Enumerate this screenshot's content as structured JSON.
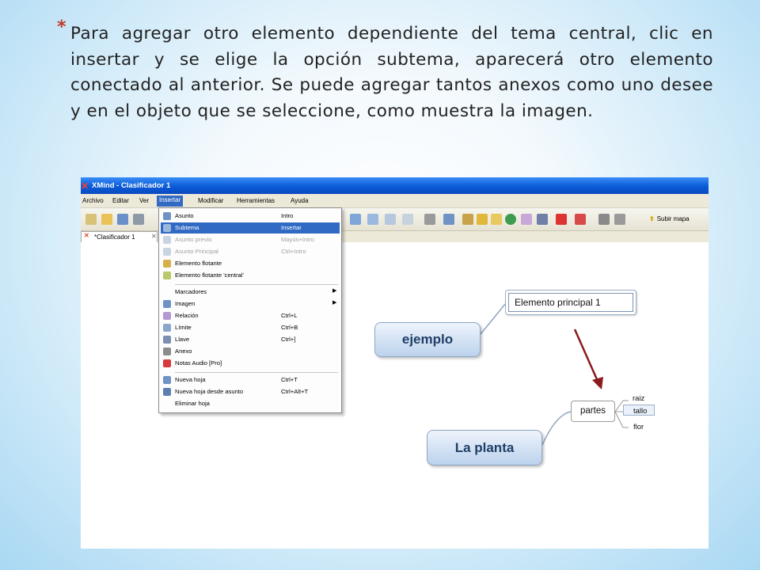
{
  "slide": {
    "bullet": "*",
    "text": "Para agregar otro elemento dependiente del tema central, clic en  insertar y se elige la opción subtema, aparecerá otro elemento conectado al anterior. Se puede agregar tantos anexos como uno desee y en el objeto que se seleccione, como muestra la imagen."
  },
  "app": {
    "window_title": "XMind - Clasificador 1",
    "menus": [
      "Archivo",
      "Editar",
      "Ver",
      "Insertar",
      "Modificar",
      "Herramientas",
      "Ayuda"
    ],
    "active_menu": "Insertar",
    "toolbar_button": "Subir mapa",
    "tab_label": "*Clasificador 1"
  },
  "dropdown": {
    "items": [
      {
        "label": "Asunto",
        "shortcut": "Intro",
        "icon": "topic-icon"
      },
      {
        "label": "Subtema",
        "shortcut": "Insertar",
        "icon": "subtopic-icon"
      },
      {
        "label": "Asunto previo",
        "shortcut": "Mayús+Intro",
        "icon": "prev-topic-icon"
      },
      {
        "label": "Asunto Principal",
        "shortcut": "Ctrl+Intro",
        "icon": "main-topic-icon"
      },
      {
        "label": "Elemento flotante",
        "shortcut": "",
        "icon": "floating-topic-icon"
      },
      {
        "label": "Elemento flotante 'central'",
        "shortcut": "",
        "icon": "floating-central-icon"
      },
      {
        "label": "Marcadores",
        "shortcut": "",
        "icon": ""
      },
      {
        "label": "Imagen",
        "shortcut": "",
        "icon": "image-icon"
      },
      {
        "label": "Relación",
        "shortcut": "Ctrl+L",
        "icon": "relation-icon"
      },
      {
        "label": "Límite",
        "shortcut": "Ctrl+B",
        "icon": "boundary-icon"
      },
      {
        "label": "Llave",
        "shortcut": "Ctrl+]",
        "icon": "summary-icon"
      },
      {
        "label": "Anexo",
        "shortcut": "",
        "icon": "attachment-icon"
      },
      {
        "label": "Notas Audio [Pro]",
        "shortcut": "",
        "icon": "audio-notes-icon"
      },
      {
        "label": "Nueva hoja",
        "shortcut": "Ctrl+T",
        "icon": "new-sheet-icon"
      },
      {
        "label": "Nueva hoja desde asunto",
        "shortcut": "Ctrl+Alt+T",
        "icon": "new-sheet-from-topic-icon"
      },
      {
        "label": "Eliminar hoja",
        "shortcut": "",
        "icon": ""
      }
    ],
    "highlighted": "Subtema"
  },
  "mindmap": {
    "central_1": "ejemplo",
    "main_topic": "Elemento principal  1",
    "central_2": "La planta",
    "subtopic": "partes",
    "leaves": [
      "raiz",
      "tallo",
      "flor"
    ]
  },
  "colors": {
    "highlight": "#316ac5",
    "arrow": "#8b1a1a",
    "node_text": "#1e3f66",
    "title_bar": "#0a5bd6"
  }
}
